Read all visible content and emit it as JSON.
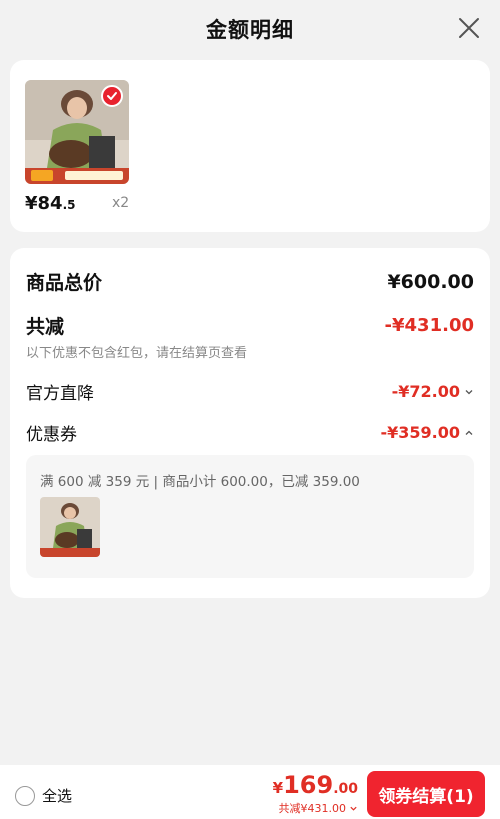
{
  "header": {
    "title": "金额明细"
  },
  "product": {
    "price_main": "¥84",
    "price_cents": ".5",
    "quantity": "x2"
  },
  "summary": {
    "goods_total_label": "商品总价",
    "goods_total_value": "¥600.00",
    "total_discount_label": "共减",
    "total_discount_value": "-¥431.00",
    "note": "以下优惠不包含红包，请在结算页查看",
    "official_drop_label": "官方直降",
    "official_drop_value": "-¥72.00",
    "coupon_label": "优惠券",
    "coupon_value": "-¥359.00",
    "coupon_detail": "满 600 减 359 元 | 商品小计 600.00，已减 359.00"
  },
  "bottom": {
    "select_all_label": "全选",
    "total_yen": "¥",
    "total_int": "169",
    "total_dec": ".00",
    "total_saved": "共减¥431.00",
    "checkout_label": "领券结算(1)"
  },
  "colors": {
    "accent_red": "#e02e24",
    "button_red": "#f0242f"
  }
}
